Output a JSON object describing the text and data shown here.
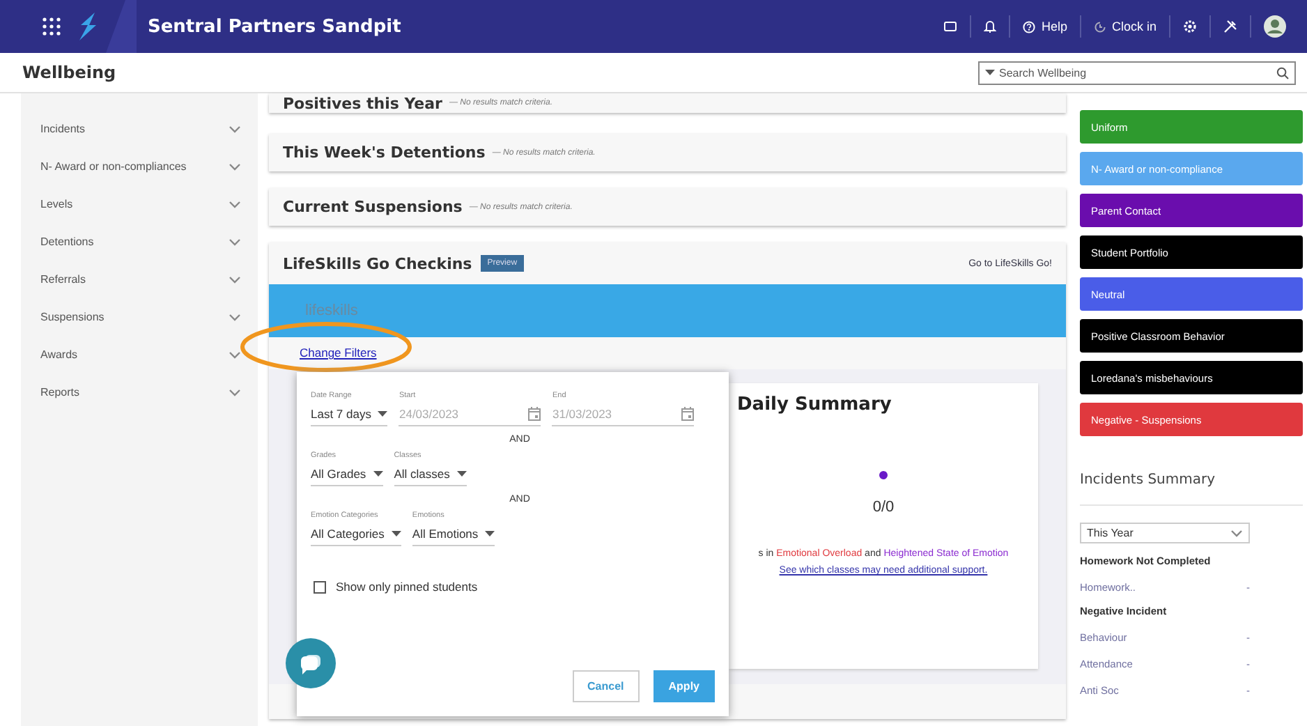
{
  "topbar": {
    "title": "Sentral Partners Sandpit",
    "actions": [
      {
        "kind": "messages"
      },
      {
        "kind": "bell"
      },
      {
        "kind": "help",
        "label": "Help"
      },
      {
        "kind": "clock",
        "label": "Clock in"
      },
      {
        "kind": "gear"
      },
      {
        "kind": "tools"
      },
      {
        "kind": "avatar"
      }
    ]
  },
  "header": {
    "title": "Wellbeing",
    "search": {
      "placeholder": "Search Wellbeing"
    }
  },
  "sidebar": {
    "items": [
      {
        "label": "Incidents",
        "expanded": false
      },
      {
        "label": "N- Award or non-compliances",
        "expanded": false
      },
      {
        "label": "Levels",
        "expanded": false
      },
      {
        "label": "Detentions",
        "expanded": false
      },
      {
        "label": "Referrals",
        "expanded": false
      },
      {
        "label": "Suspensions",
        "expanded": false
      },
      {
        "label": "Awards",
        "expanded": false
      },
      {
        "label": "Reports",
        "expanded": false
      }
    ]
  },
  "panels": [
    {
      "title": "Positives this Year",
      "note": "— No results match criteria."
    },
    {
      "title": "This Week's Detentions",
      "note": "— No results match criteria."
    },
    {
      "title": "Current Suspensions",
      "note": "— No results match criteria."
    }
  ],
  "lifeskills": {
    "title": "LifeSkills Go Checkins",
    "badge": "Preview",
    "link": "Go to LifeSkills Go!",
    "brand": "lifeskills",
    "change_filters": "Change Filters",
    "filters": {
      "rows": [
        {
          "kind": "fields",
          "fields": [
            {
              "kind": "select",
              "label": "Date Range",
              "value": "Last 7 days"
            },
            {
              "kind": "date",
              "label": "Start",
              "value": "24/03/2023",
              "disabled": true
            },
            {
              "kind": "date",
              "label": "End",
              "value": "31/03/2023",
              "disabled": true
            }
          ]
        },
        {
          "kind": "separator",
          "text": "AND"
        },
        {
          "kind": "fields",
          "fields": [
            {
              "kind": "select",
              "label": "Grades",
              "value": "All Grades"
            },
            {
              "kind": "select",
              "label": "Classes",
              "value": "All classes"
            }
          ]
        },
        {
          "kind": "separator",
          "text": "AND"
        },
        {
          "kind": "fields",
          "fields": [
            {
              "kind": "select",
              "label": "Emotion Categories",
              "value": "All Categories"
            },
            {
              "kind": "select",
              "label": "Emotions",
              "value": "All Emotions"
            }
          ]
        }
      ],
      "checkbox": {
        "label": "Show only pinned students",
        "checked": false
      },
      "buttons": [
        {
          "label": "Cancel",
          "kind": "secondary"
        },
        {
          "label": "Apply",
          "kind": "primary"
        }
      ]
    },
    "summary": {
      "title": "Daily Summary",
      "count": "0/0",
      "text": [
        {
          "text": "s in ",
          "color": "#333333"
        },
        {
          "text": "Emotional Overload",
          "color": "#e0393e"
        },
        {
          "text": " and ",
          "color": "#333333"
        },
        {
          "text": "Heightened State of Emotion",
          "color": "#8a2ad0"
        }
      ],
      "link": "See which classes may need additional support."
    }
  },
  "categories": [
    {
      "label": "Uniform",
      "color": "#2e9a2e"
    },
    {
      "label": "N- Award or non-compliance",
      "color": "#5aa8ee"
    },
    {
      "label": "Parent Contact",
      "color": "#6a0dad"
    },
    {
      "label": "Student Portfolio",
      "color": "#000000"
    },
    {
      "label": "Neutral",
      "color": "#4a5de8"
    },
    {
      "label": "Positive Classroom Behavior",
      "color": "#000000"
    },
    {
      "label": "Loredana's misbehaviours",
      "color": "#000000"
    },
    {
      "label": "Negative - Suspensions",
      "color": "#e0393e"
    }
  ],
  "incidents_summary": {
    "title": "Incidents Summary",
    "period": "This Year",
    "groups": [
      {
        "title": "Homework Not Completed",
        "items": [
          {
            "label": "Homework..",
            "count": "-"
          }
        ]
      },
      {
        "title": "Negative Incident",
        "items": [
          {
            "label": "Behaviour",
            "count": "-"
          },
          {
            "label": "Attendance",
            "count": "-"
          },
          {
            "label": "Anti Soc",
            "count": "-"
          }
        ]
      }
    ]
  }
}
